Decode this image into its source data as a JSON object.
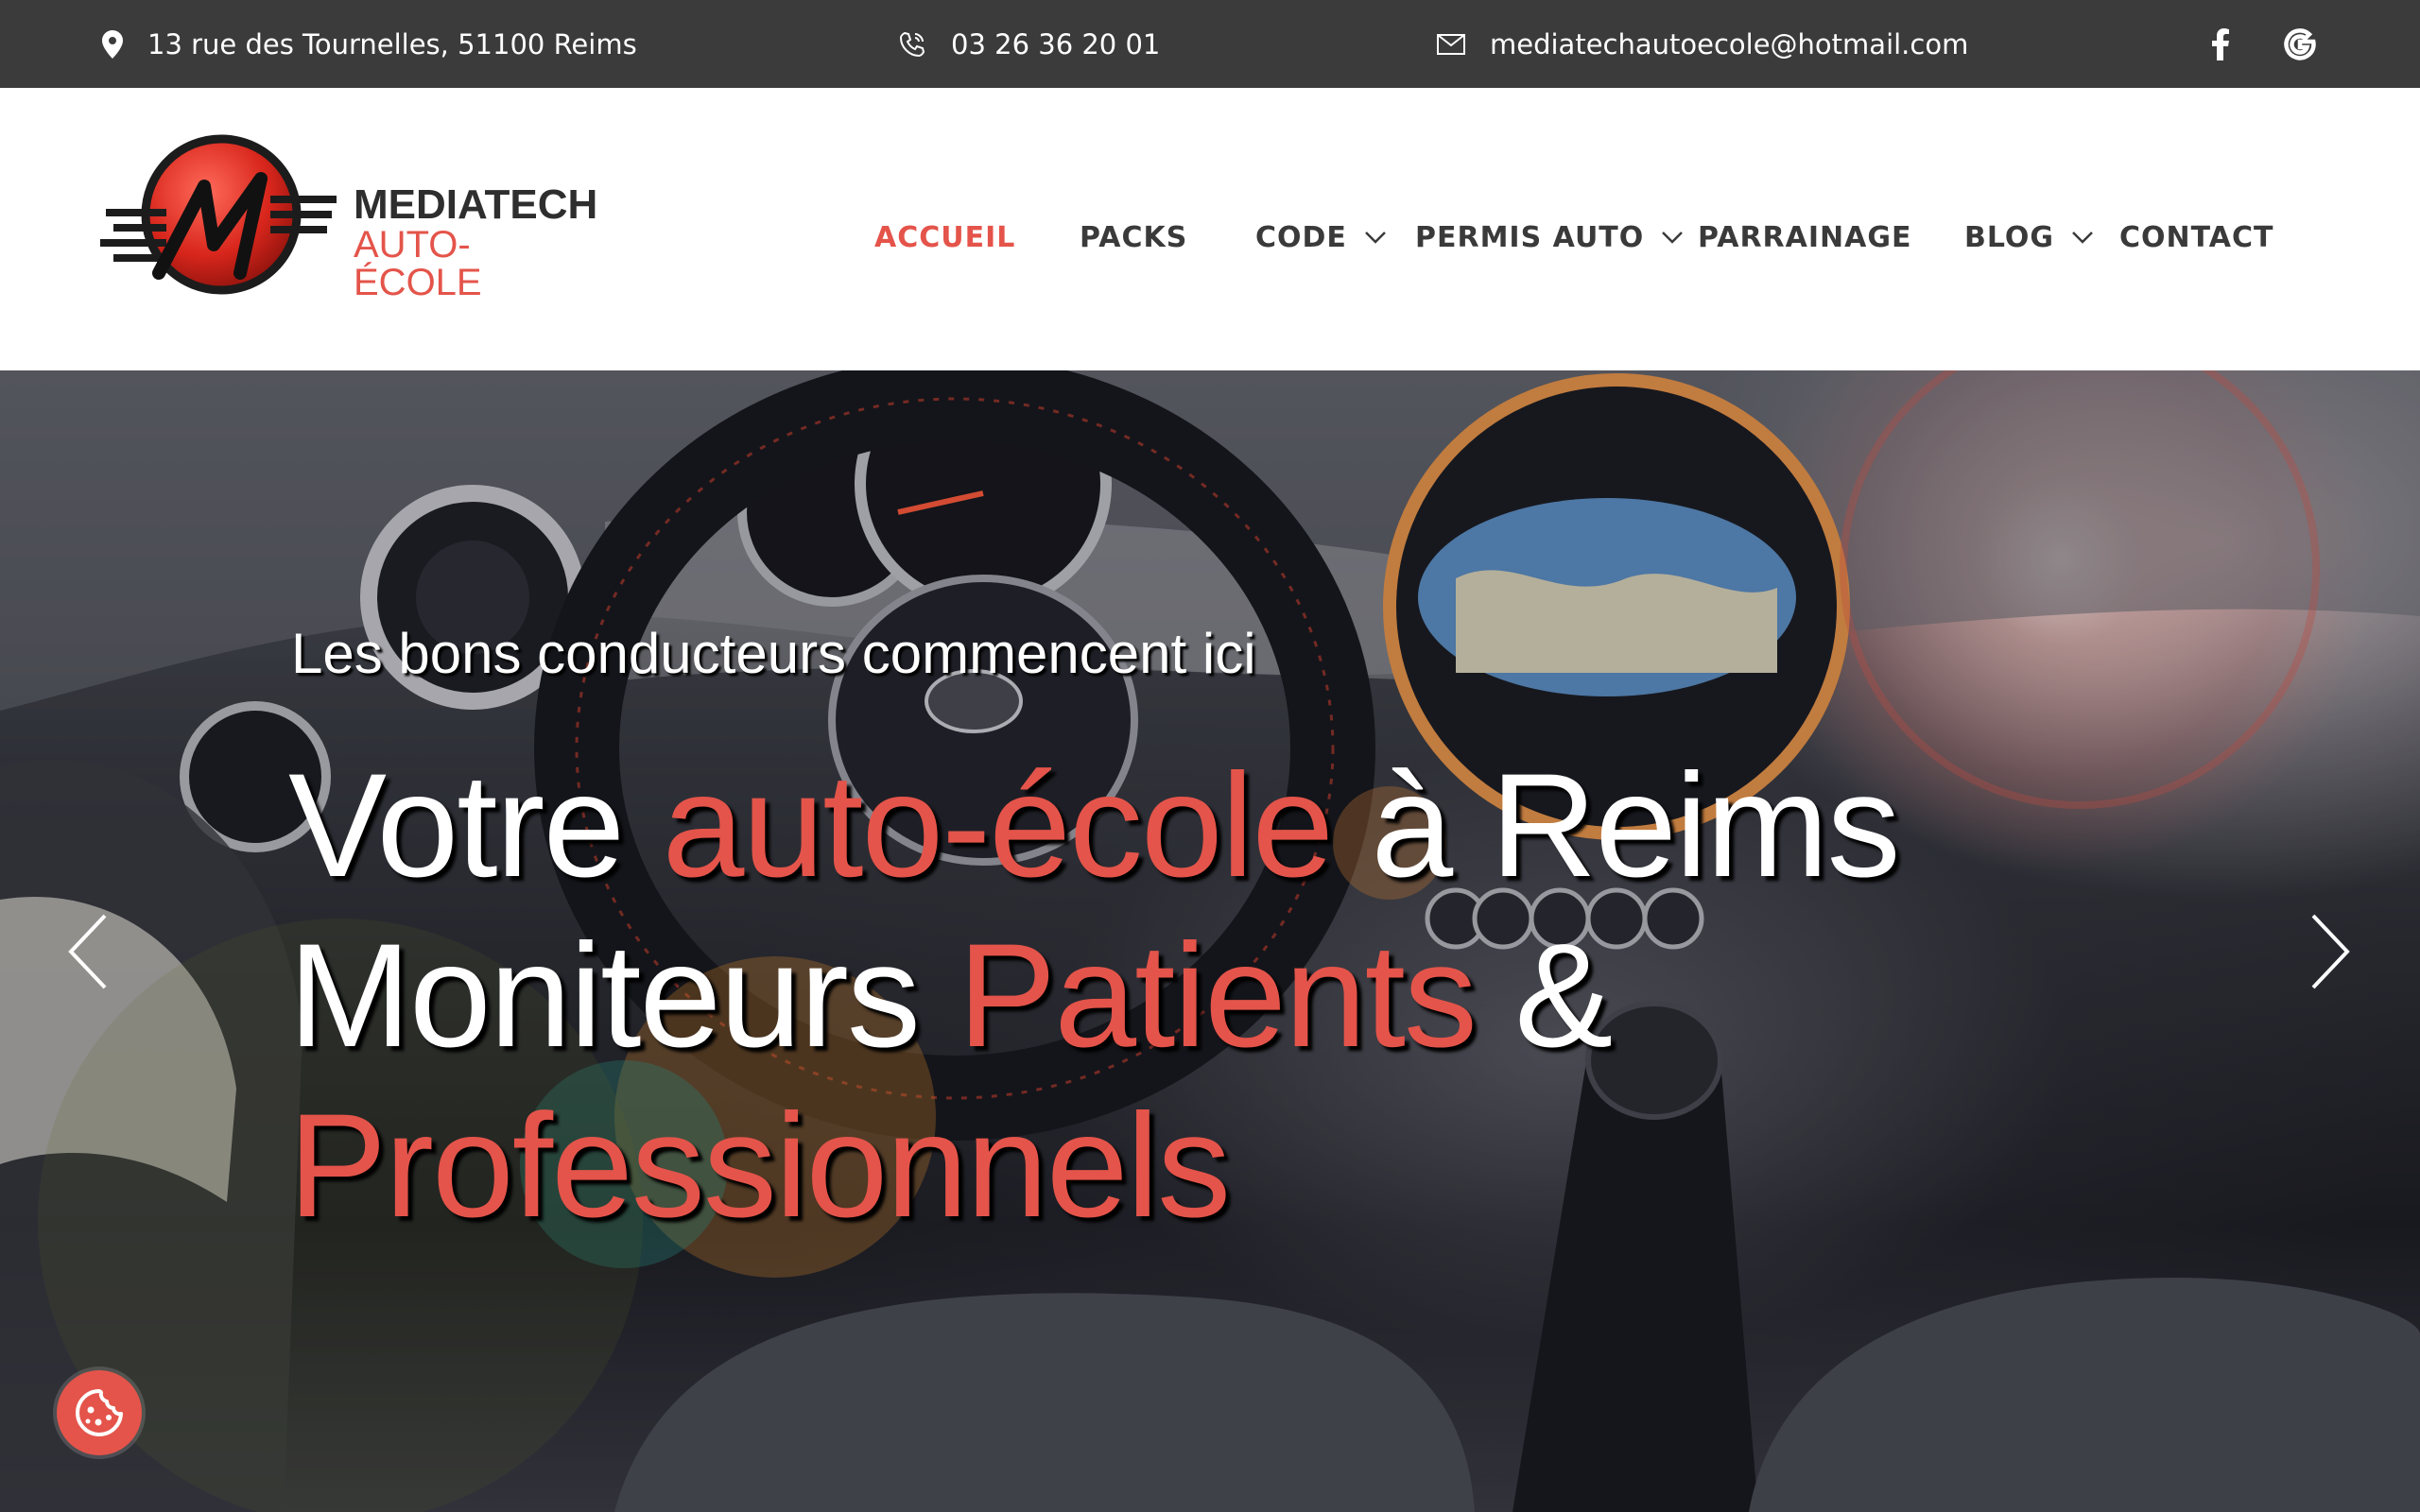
{
  "topbar": {
    "address": "13 rue des Tournelles, 51100 Reims",
    "phone": "03 26 36 20 01",
    "email": "mediatechautoecole@hotmail.com",
    "social": [
      "facebook-icon",
      "google-icon"
    ]
  },
  "logo": {
    "line1": "MEDIATECH",
    "line2": "AUTO-ÉCOLE"
  },
  "nav": {
    "items": [
      {
        "label": "ACCUEIL",
        "active": true,
        "dropdown": false
      },
      {
        "label": "PACKS",
        "active": false,
        "dropdown": false
      },
      {
        "label": "CODE",
        "active": false,
        "dropdown": true
      },
      {
        "label": "PERMIS AUTO",
        "active": false,
        "dropdown": true
      },
      {
        "label": "PARRAINAGE",
        "active": false,
        "dropdown": false
      },
      {
        "label": "BLOG",
        "active": false,
        "dropdown": true
      },
      {
        "label": "CONTACT",
        "active": false,
        "dropdown": false
      }
    ]
  },
  "hero": {
    "kicker": "Les bons conducteurs commencent ici",
    "line1": {
      "a": "Votre ",
      "b": "auto-école",
      "c": " à Reims"
    },
    "line2": {
      "a": "Moniteurs ",
      "b": "Patients",
      "c": " &"
    },
    "line3": {
      "b": "Professionnels"
    }
  },
  "colors": {
    "accent": "#e4544a",
    "topbar": "#3b3b3b",
    "nav_text": "#3a3a3a"
  }
}
